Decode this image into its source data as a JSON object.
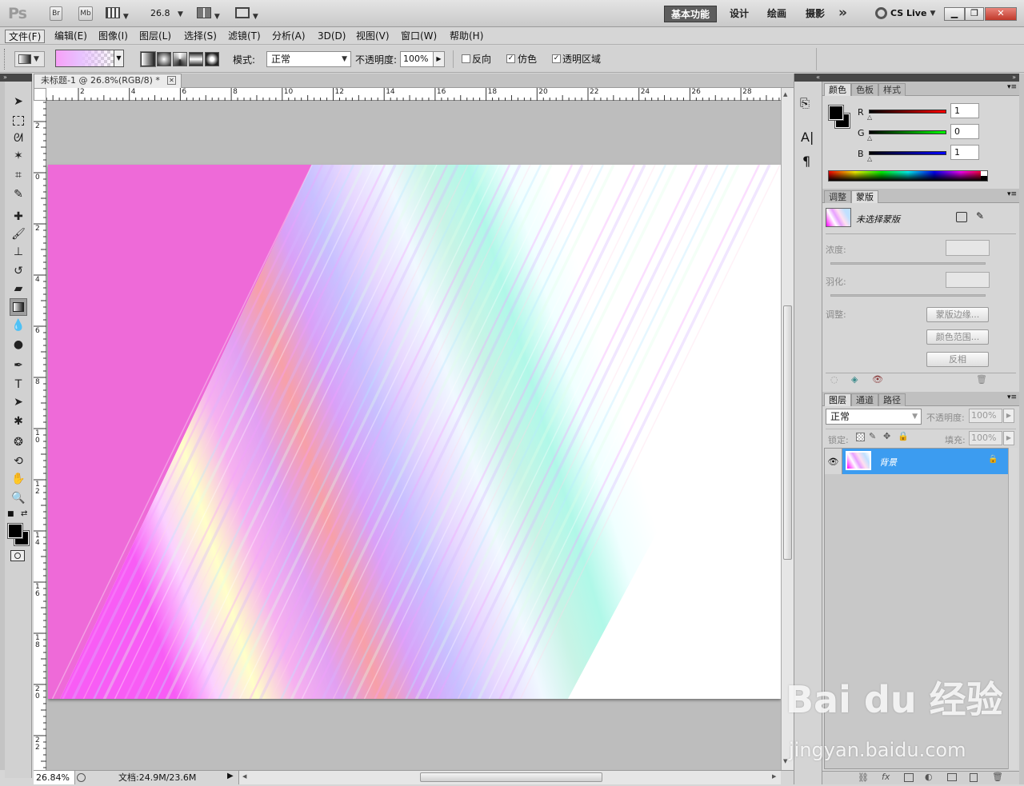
{
  "app": {
    "logo": "Ps"
  },
  "titlebar": {
    "bridge_label": "Br",
    "minibridge_label": "Mb",
    "zoom_value": "26.8",
    "workspaces": [
      "基本功能",
      "设计",
      "绘画",
      "摄影"
    ],
    "more_label": "»",
    "cslive_label": "CS Live"
  },
  "menu": [
    "文件(F)",
    "编辑(E)",
    "图像(I)",
    "图层(L)",
    "选择(S)",
    "滤镜(T)",
    "分析(A)",
    "3D(D)",
    "视图(V)",
    "窗口(W)",
    "帮助(H)"
  ],
  "options": {
    "mode_label": "模式:",
    "mode_value": "正常",
    "opacity_label": "不透明度:",
    "opacity_value": "100%",
    "reverse_label": "反向",
    "reverse_checked": false,
    "dither_label": "仿色",
    "dither_checked": true,
    "transparency_label": "透明区域",
    "transparency_checked": true
  },
  "document": {
    "tab_title": "未标题-1 @ 26.8%(RGB/8) *",
    "ruler_h": [
      "2",
      "4",
      "6",
      "8",
      "10",
      "12",
      "14",
      "16",
      "18",
      "20",
      "22",
      "24",
      "26",
      "28"
    ],
    "ruler_v": [
      "2",
      "0",
      "2",
      "4",
      "6",
      "8",
      "1 0",
      "1 2",
      "1 4",
      "1 6",
      "1 8",
      "2 0",
      "2 2"
    ],
    "gradient_colors": [
      "#ee6ad8",
      "#f85cf5",
      "#fbd0ff",
      "#ffffc8",
      "#f6b0f0",
      "#e1a0f2",
      "#f7a0a8",
      "#d9a0f8",
      "#c8c0ff",
      "#e8d8ff",
      "#f0f8ff",
      "#c8f4e6",
      "#b0f8e8",
      "#f0ffff",
      "#ffffff"
    ]
  },
  "status": {
    "zoom": "26.84%",
    "doc_size": "文档:24.9M/23.6M"
  },
  "color_panel": {
    "tabs": [
      "颜色",
      "色板",
      "样式"
    ],
    "r_label": "R",
    "r_value": "1",
    "g_label": "G",
    "g_value": "0",
    "b_label": "B",
    "b_value": "1"
  },
  "masks_panel": {
    "tabs": [
      "调整",
      "蒙版"
    ],
    "no_mask": "未选择蒙版",
    "density_label": "浓度:",
    "feather_label": "羽化:",
    "refine_label": "调整:",
    "mask_edge_button": "蒙版边缘...",
    "color_range_button": "颜色范围...",
    "invert_button": "反相"
  },
  "layers_panel": {
    "tabs": [
      "图层",
      "通道",
      "路径"
    ],
    "blend_mode": "正常",
    "opacity_label": "不透明度:",
    "opacity_value": "100%",
    "lock_label": "锁定:",
    "fill_label": "填充:",
    "fill_value": "100%",
    "layer_name": "背景"
  },
  "watermark": {
    "brand": "Bai du 经验",
    "url": "jingyan.baidu.com"
  },
  "colors": {
    "accent": "#3c9cf0",
    "active_workspace": "#5d5d5d"
  }
}
